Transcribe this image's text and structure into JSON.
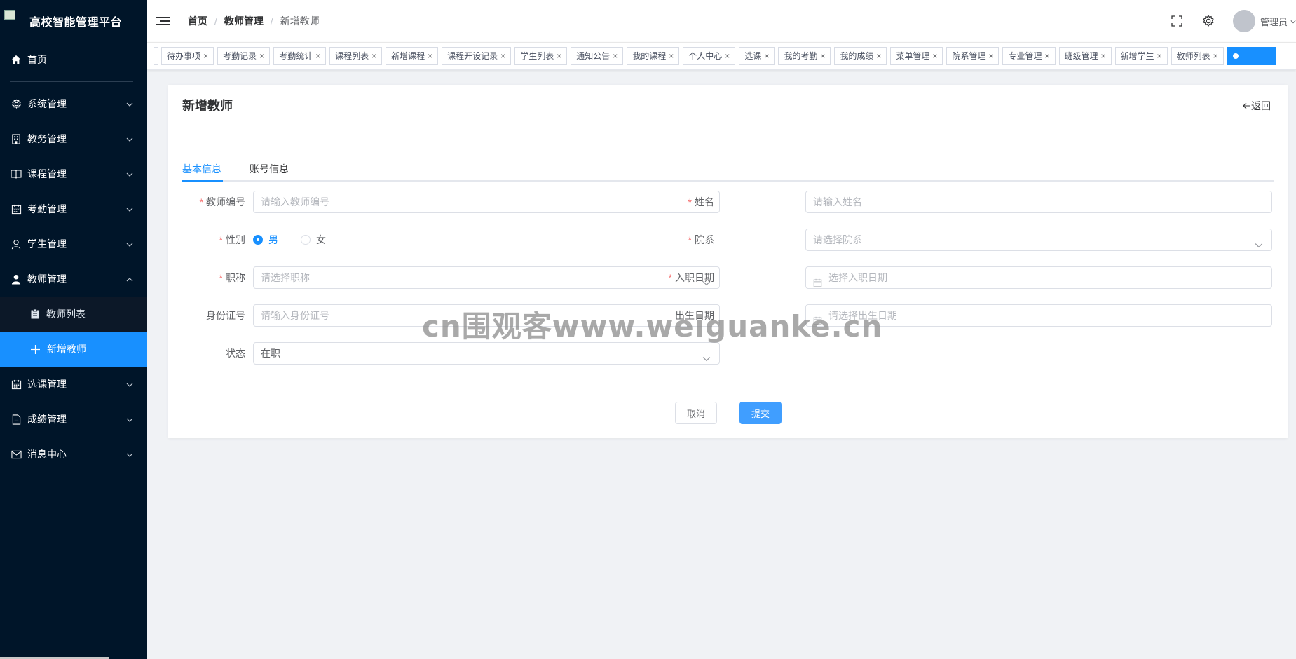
{
  "app": {
    "title": "高校智能管理平台"
  },
  "sidebar": {
    "home": "首页",
    "items": [
      {
        "label": "系统管理",
        "icon": "gear-icon"
      },
      {
        "label": "教务管理",
        "icon": "building-icon"
      },
      {
        "label": "课程管理",
        "icon": "book-icon"
      },
      {
        "label": "考勤管理",
        "icon": "calendar-icon"
      },
      {
        "label": "学生管理",
        "icon": "user-icon"
      },
      {
        "label": "教师管理",
        "icon": "user-filled-icon"
      },
      {
        "label": "选课管理",
        "icon": "calendar-icon"
      },
      {
        "label": "成绩管理",
        "icon": "document-icon"
      },
      {
        "label": "消息中心",
        "icon": "mail-icon"
      }
    ],
    "teacher_sub": [
      "教师列表",
      "新增教师"
    ]
  },
  "header": {
    "breadcrumb": [
      "首页",
      "教师管理",
      "新增教师"
    ],
    "user": "管理员"
  },
  "tags": [
    "待办事项",
    "考勤记录",
    "考勤统计",
    "课程列表",
    "新增课程",
    "课程开设记录",
    "学生列表",
    "通知公告",
    "我的课程",
    "个人中心",
    "选课",
    "我的考勤",
    "我的成绩",
    "菜单管理",
    "院系管理",
    "专业管理",
    "班级管理",
    "新增学生",
    "教师列表"
  ],
  "card": {
    "title": "新增教师",
    "back": "返回",
    "tabs": [
      "基本信息",
      "账号信息"
    ]
  },
  "form": {
    "teacher_no": {
      "label": "教师编号",
      "placeholder": "请输入教师编号"
    },
    "name": {
      "label": "姓名",
      "placeholder": "请输入姓名"
    },
    "gender": {
      "label": "性别",
      "options": [
        "男",
        "女"
      ],
      "selected": "男"
    },
    "department": {
      "label": "院系",
      "placeholder": "请选择院系"
    },
    "title": {
      "label": "职称",
      "placeholder": "请选择职称"
    },
    "hire_date": {
      "label": "入职日期",
      "placeholder": "选择入职日期"
    },
    "id_card": {
      "label": "身份证号",
      "placeholder": "请输入身份证号"
    },
    "birth_date": {
      "label": "出生日期",
      "placeholder": "请选择出生日期"
    },
    "status": {
      "label": "状态",
      "value": "在职"
    }
  },
  "buttons": {
    "cancel": "取消",
    "submit": "提交"
  },
  "watermark": "cn围观客www.weiguanke.cn",
  "colors": {
    "sidebar_bg": "#001529",
    "primary": "#1890ff",
    "required": "#f56c6c"
  }
}
